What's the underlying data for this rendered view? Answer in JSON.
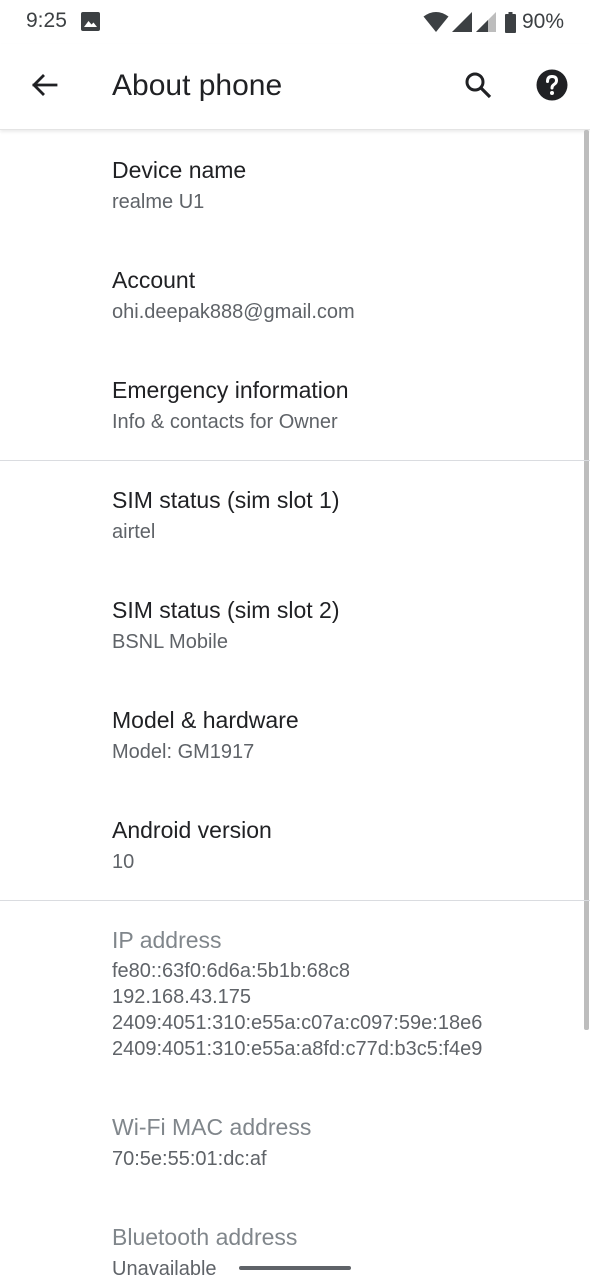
{
  "status_bar": {
    "time": "9:25",
    "battery": "90%",
    "icons": [
      "photo-icon",
      "wifi-icon",
      "signal-icon",
      "signal-icon",
      "battery-icon"
    ]
  },
  "app_bar": {
    "title": "About phone",
    "icons": [
      "back-arrow-icon",
      "search-icon",
      "help-icon"
    ]
  },
  "items": [
    {
      "title": "Device name",
      "subtitle": "realme U1"
    },
    {
      "title": "Account",
      "subtitle": "ohi.deepak888@gmail.com"
    },
    {
      "title": "Emergency information",
      "subtitle": "Info & contacts for Owner"
    },
    {
      "title": "SIM status (sim slot 1)",
      "subtitle": "airtel"
    },
    {
      "title": "SIM status (sim slot 2)",
      "subtitle": "BSNL Mobile"
    },
    {
      "title": "Model & hardware",
      "subtitle": "Model: GM1917"
    },
    {
      "title": "Android version",
      "subtitle": "10"
    }
  ],
  "ip_address": {
    "title": "IP address",
    "values": [
      "fe80::63f0:6d6a:5b1b:68c8",
      "192.168.43.175",
      "2409:4051:310:e55a:c07a:c097:59e:18e6",
      "2409:4051:310:e55a:a8fd:c77d:b3c5:f4e9"
    ]
  },
  "wifi_mac": {
    "title": "Wi-Fi MAC address",
    "subtitle": "70:5e:55:01:dc:af"
  },
  "bluetooth": {
    "title": "Bluetooth address",
    "subtitle": "Unavailable"
  }
}
